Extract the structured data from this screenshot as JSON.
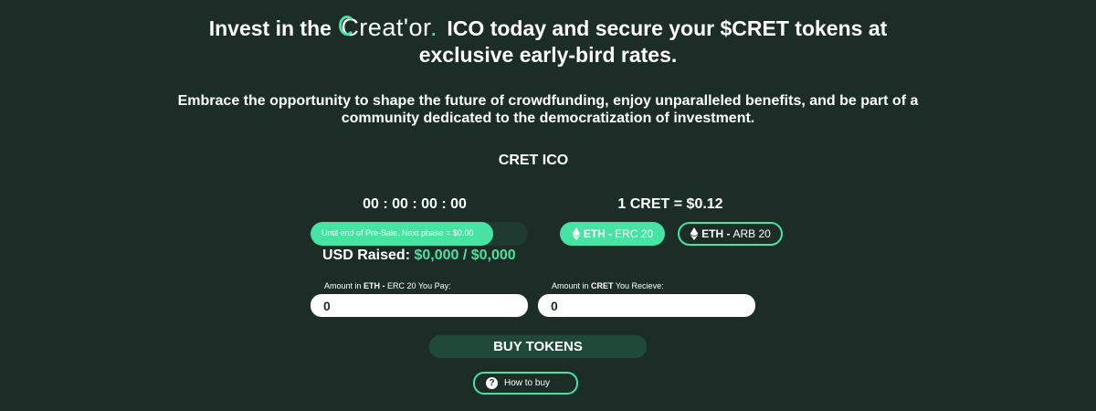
{
  "headline": {
    "before": "Invest in the ",
    "logo": "Creat'or",
    "logo_dot": ".",
    "after": " ICO today and secure your $CRET tokens at",
    "line2": "exclusive early-bird rates."
  },
  "subheadline": {
    "line1": "Embrace the opportunity to shape the future of crowdfunding, enjoy unparalleled benefits, and be part of a",
    "line2": "community dedicated to the democratization of investment."
  },
  "ico": {
    "title": "CRET ICO",
    "countdown": "00 : 00 : 00 : 00",
    "progress_fraction": 0.84,
    "progress_text": "Until end of Pre-Sale. Next phase = $0.00",
    "usd_raised_label": "USD Raised: ",
    "usd_raised_value": "$0,000 / $0,000",
    "rate": "1 CRET = $0.12"
  },
  "networks": [
    {
      "bold": "ETH -",
      "rest": "ERC 20",
      "selected": true,
      "icon": "ethereum-icon"
    },
    {
      "bold": "ETH -",
      "rest": "ARB 20",
      "selected": false,
      "icon": "ethereum-icon"
    }
  ],
  "pay_field": {
    "label_pre": "Amount in ",
    "label_bold": "ETH -",
    "label_post": " ERC 20 You Pay:",
    "value": "0"
  },
  "receive_field": {
    "label_pre": "Amount in ",
    "label_bold": "CRET",
    "label_post": " You Recieve:",
    "value": "0"
  },
  "buy_button": "BUY TOKENS",
  "how_to_buy": {
    "label": "How to buy",
    "icon": "question-icon"
  },
  "colors": {
    "background": "#1c2d28",
    "accent": "#47e3a2",
    "dark_button": "#1f4a3a"
  }
}
